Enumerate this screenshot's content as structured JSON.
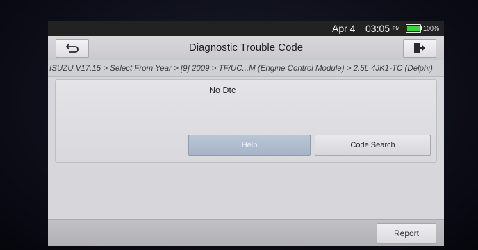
{
  "statusbar": {
    "date": "Apr 4",
    "time": "03:05",
    "ampm": "PM",
    "battery_percent": "100%",
    "battery_level": 1.0,
    "battery_color": "#3fd13f"
  },
  "header": {
    "title": "Diagnostic Trouble Code",
    "back_icon": "back-arrow-icon",
    "exit_icon": "exit-door-icon"
  },
  "breadcrumb": "ISUZU V17.15 > Select From Year > [9] 2009 > TF/UC...M (Engine Control Module) > 2.5L 4JK1-TC (Delphi)",
  "content": {
    "message": "No Dtc",
    "help_label": "Help",
    "code_search_label": "Code Search"
  },
  "footer": {
    "report_label": "Report"
  }
}
